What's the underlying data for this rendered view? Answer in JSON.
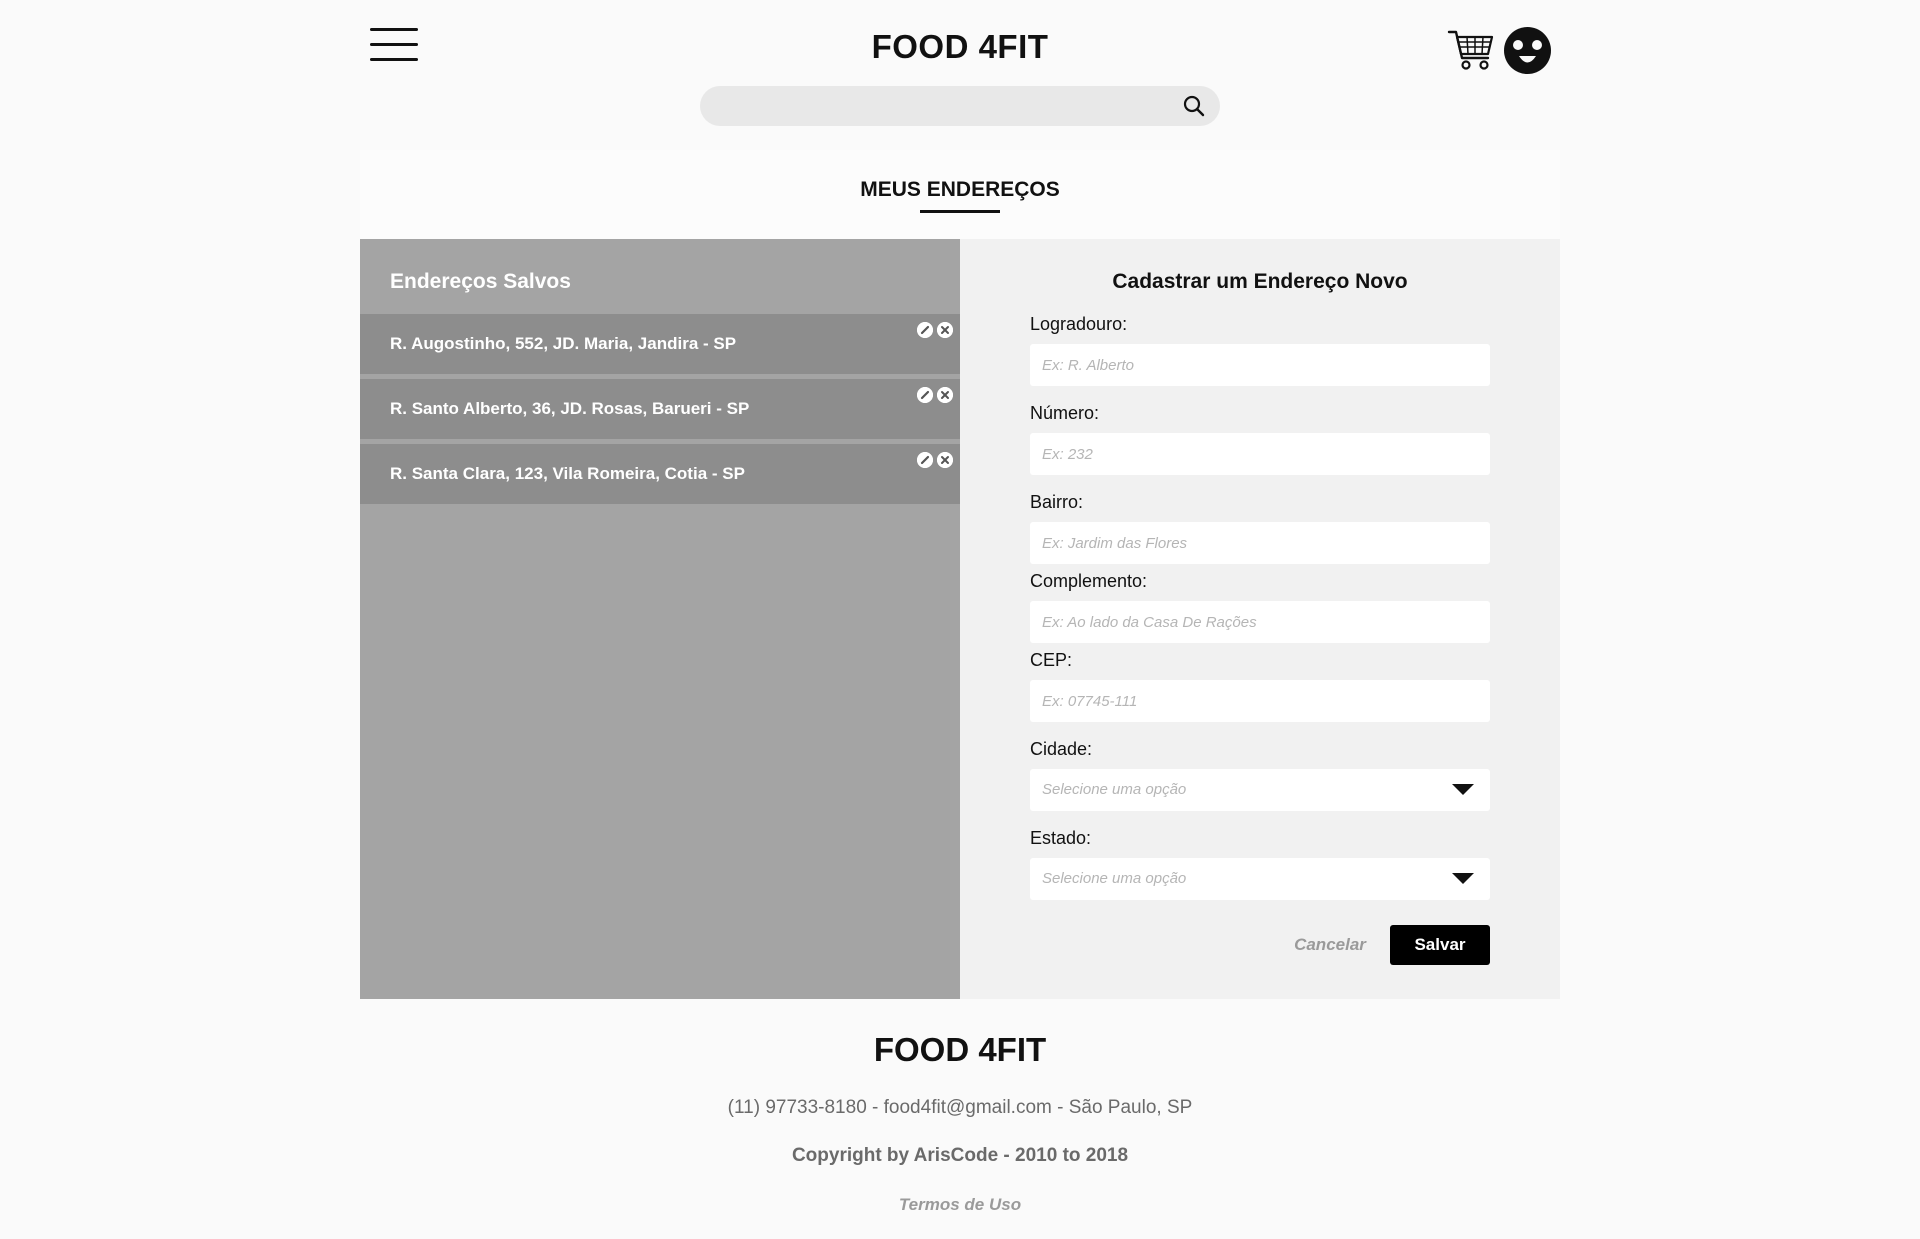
{
  "header": {
    "brand": "FOOD 4FIT",
    "search": {
      "placeholder": "",
      "value": ""
    },
    "icons": [
      "menu-icon",
      "search-icon",
      "cart-icon",
      "avatar-icon"
    ]
  },
  "main": {
    "title": "MEUS ENDEREÇOS",
    "saved": {
      "title": "Endereços Salvos",
      "addresses": [
        {
          "text": "R. Augostinho, 552, JD. Maria, Jandira - SP"
        },
        {
          "text": "R. Santo Alberto, 36, JD. Rosas, Barueri - SP"
        },
        {
          "text": "R. Santa Clara, 123, Vila Romeira, Cotia - SP"
        }
      ]
    },
    "form": {
      "title": "Cadastrar um Endereço Novo",
      "fields": {
        "logradouro": {
          "label": "Logradouro:",
          "placeholder": "Ex: R. Alberto",
          "value": ""
        },
        "numero": {
          "label": "Número:",
          "placeholder": "Ex: 232",
          "value": ""
        },
        "bairro": {
          "label": "Bairro:",
          "placeholder": "Ex: Jardim das Flores",
          "value": ""
        },
        "complemento": {
          "label": "Complemento:",
          "placeholder": "Ex: Ao lado da Casa De Rações",
          "value": ""
        },
        "cep": {
          "label": "CEP:",
          "placeholder": "Ex: 07745-111",
          "value": ""
        },
        "cidade": {
          "label": "Cidade:",
          "selected": "Selecione uma opção"
        },
        "estado": {
          "label": "Estado:",
          "selected": "Selecione uma opção"
        }
      },
      "cancel_label": "Cancelar",
      "save_label": "Salvar"
    }
  },
  "footer": {
    "brand": "FOOD 4FIT",
    "contact": "(11) 97733-8180 - food4fit@gmail.com - São Paulo, SP",
    "copyright": "Copyright by ArisCode - 2010 to 2018",
    "terms": "Termos de Uso"
  },
  "colors": {
    "background": "#fafafa",
    "saved_panel": "#a4a4a4",
    "address_row": "#8d8d8d",
    "form_panel": "#f1f1f1",
    "primary_button": "#000000"
  }
}
